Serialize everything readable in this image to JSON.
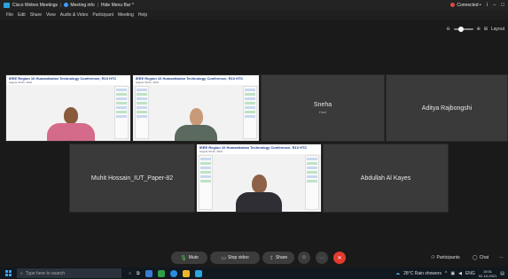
{
  "titlebar": {
    "app_name": "Cisco Webex Meetings",
    "meeting_info": "Meeting info",
    "hide_menu": "Hide Menu Bar ^",
    "status": "Connected •"
  },
  "menu": [
    "File",
    "Edit",
    "Share",
    "View",
    "Audio & Video",
    "Participant",
    "Meeting",
    "Help"
  ],
  "layout": {
    "label": "Layout"
  },
  "tiles": {
    "sneha": {
      "name": "Sneha",
      "sub": "Host"
    },
    "aditya": {
      "name": "Aditya Rajbongshi"
    },
    "muhit": {
      "name": "Muhit Hossain_IUT_Paper-82"
    },
    "abdullah": {
      "name": "Abdullah Al Kayes"
    },
    "video_banner_title": "IEEE Region 10 Humanitarian Technology Conference, R10 HTC",
    "video_banner_sub": "August 30-31, 2021"
  },
  "controls": {
    "mute": "Mute",
    "stop_video": "Stop video",
    "share": "Share",
    "participants": "Participants",
    "chat": "Chat"
  },
  "taskbar": {
    "search_placeholder": "Type here to search",
    "weather": "28°C  Rain showers",
    "lang": "ENG",
    "time": "15:01",
    "date": "02-10-2021"
  },
  "colors": {
    "accent": "#2aa3e0",
    "end_call": "#e23b2d",
    "mute_green": "#4ccf5c",
    "tile_bg": "#3a3a3a"
  }
}
